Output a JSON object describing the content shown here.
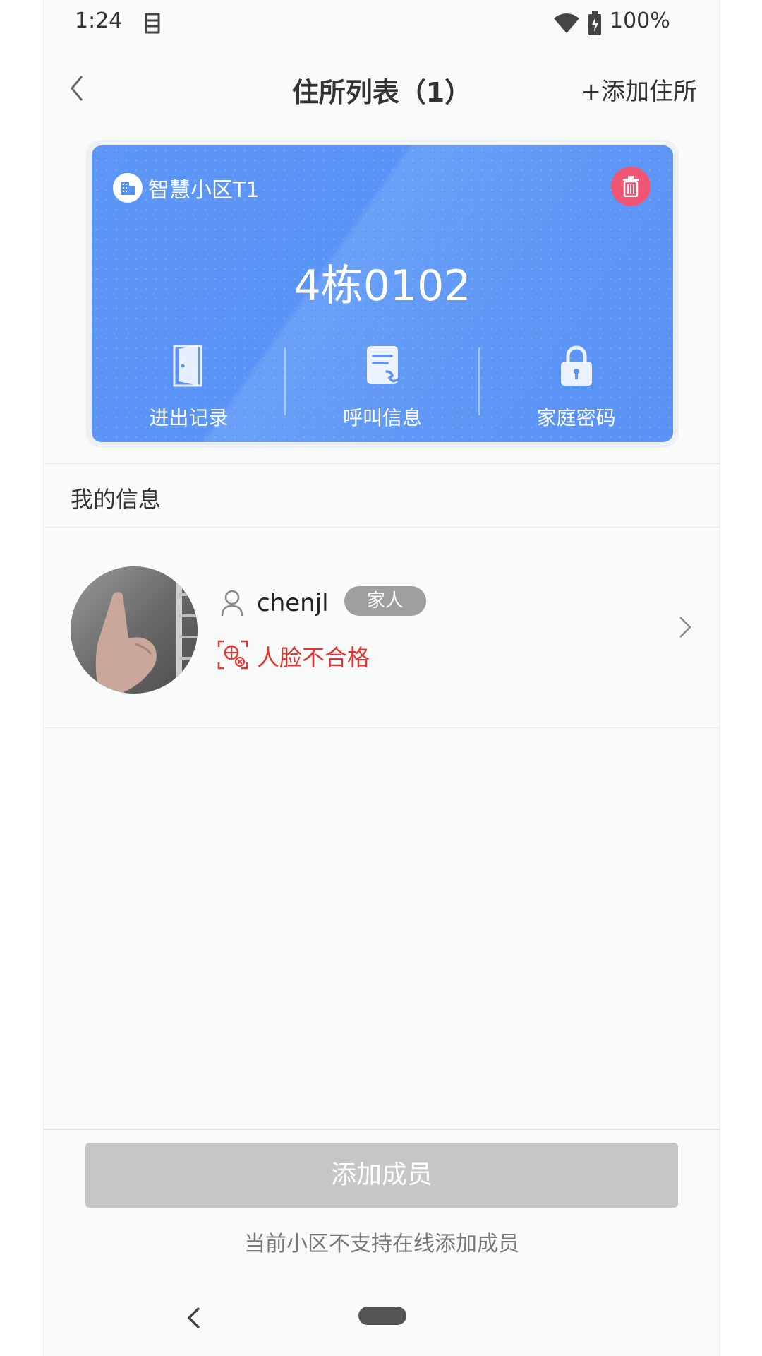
{
  "status_bar": {
    "time": "1:24",
    "battery": "100%",
    "icons": [
      "sim-icon",
      "wifi-icon",
      "battery-charging-icon"
    ]
  },
  "header": {
    "title": "住所列表（1）",
    "add_label": "+添加住所",
    "back_icon": "chevron-left-icon"
  },
  "residence_card": {
    "community": "智慧小区T1",
    "room": "4栋0102",
    "actions": [
      {
        "label": "进出记录",
        "icon": "door-icon"
      },
      {
        "label": "呼叫信息",
        "icon": "call-record-icon"
      },
      {
        "label": "家庭密码",
        "icon": "lock-icon"
      }
    ],
    "colors": {
      "card": "#5a93f6",
      "delete": "#f05674"
    }
  },
  "my_info": {
    "section_title": "我的信息",
    "member": {
      "name": "chenjl",
      "role": "家人",
      "face_status": "人脸不合格",
      "face_status_color": "#e3352f"
    }
  },
  "footer": {
    "add_member_label": "添加成员",
    "hint": "当前小区不支持在线添加成员"
  }
}
